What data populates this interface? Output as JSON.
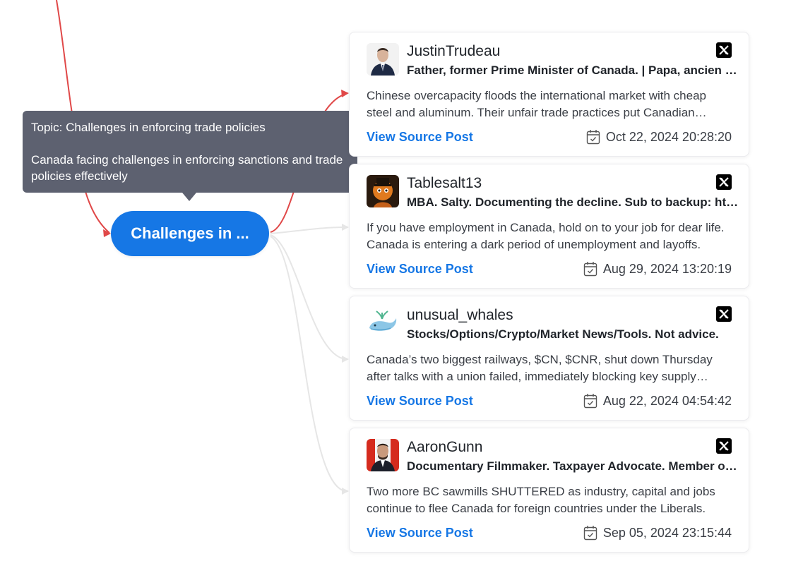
{
  "colors": {
    "accent": "#1677e5",
    "tooltip_bg": "#5d6170",
    "active_connector": "#e04848",
    "inactive_connector": "#e6e6e6"
  },
  "tooltip": {
    "topic_line": "Topic: Challenges in enforcing trade policies",
    "description": "Canada facing challenges in enforcing sanctions and trade policies effectively"
  },
  "topic_node": {
    "label": "Challenges in ..."
  },
  "posts": [
    {
      "username": "JustinTrudeau",
      "bio": "Father, former Prime Minister of Canada. | Papa, ancien premier ministre du Canada.",
      "text": "Chinese overcapacity floods the international market with cheap steel and aluminum. Their unfair trade practices put Canadian workers at a disadvantage.",
      "link_label": "View Source Post",
      "date": "Oct 22, 2024 20:28:20",
      "platform_icon": "x-logo-icon",
      "avatar_icon": "avatar-photo-man-suit"
    },
    {
      "username": "Tablesalt13",
      "bio": "MBA. Salty. Documenting the decline. Sub to backup: https",
      "text": "If you have employment in Canada, hold on to your job for dear life. Canada is entering a dark period of unemployment and layoffs.",
      "link_label": "View Source Post",
      "date": "Aug 29, 2024 13:20:19",
      "platform_icon": "x-logo-icon",
      "avatar_icon": "avatar-illustration-orange"
    },
    {
      "username": "unusual_whales",
      "bio": "Stocks/Options/Crypto/Market News/Tools. Not advice.",
      "text": "Canada’s two biggest railways, $CN, $CNR, shut down Thursday after talks with a union failed, immediately blocking key supply chains.",
      "link_label": "View Source Post",
      "date": "Aug 22, 2024 04:54:42",
      "platform_icon": "x-logo-icon",
      "avatar_icon": "avatar-whale-logo"
    },
    {
      "username": "AaronGunn",
      "bio": "Documentary Filmmaker. Taxpayer Advocate. Member of Parliament.",
      "text": "Two more BC sawmills SHUTTERED as industry, capital and jobs continue to flee Canada for foreign countries under the Liberals.",
      "link_label": "View Source Post",
      "date": "Sep 05, 2024 23:15:44",
      "platform_icon": "x-logo-icon",
      "avatar_icon": "avatar-photo-man-flag"
    }
  ]
}
